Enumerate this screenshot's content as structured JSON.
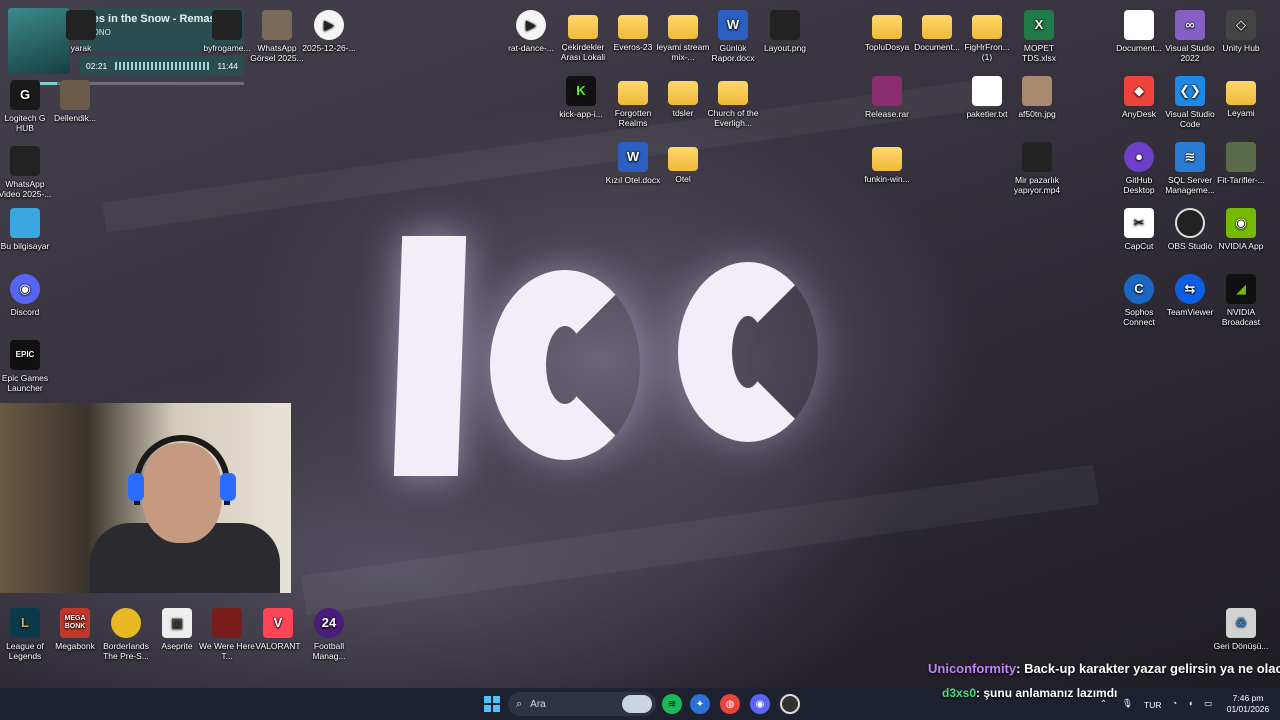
{
  "media": {
    "title": "hes in the Snow - Remastered",
    "artist": "MONO",
    "elapsed": "02:21",
    "duration": "11:44",
    "progress": 0.2
  },
  "desktop_icons": {
    "yarak": "yarak",
    "byfrogame": "byfrogame...",
    "whatsapp_gorsel": "WhatsApp Görsel 2025...",
    "video_2025": "2025-12-26-...",
    "rat_dance": "rat-dance-...",
    "cekirdekler": "Çekirdekler Arası Lokali",
    "everos": "Everos-23",
    "leyami_stream": "leyami stream mix-...",
    "gunluk_rapor": "Günlük Rapor.docx",
    "layout_png": "Layout.png",
    "toplu_dosya": "TopluDosya",
    "documents1": "Document...",
    "fighfron": "FigHrFron... (1)",
    "mopet": "MOPET TDS.xlsx",
    "documents2": "Document...",
    "vs2022": "Visual Studio 2022",
    "unity_hub": "Unity Hub",
    "logitech": "Logitech G HUB",
    "dellendik": "Dellendik...",
    "kick_app": "kick-app-i...",
    "forgotten_realms": "Forgotten Realms",
    "tdsler": "tdsler",
    "church": "Church of the Everligh...",
    "release_rar": "Release.rar",
    "paketler": "paketler.txt",
    "af50tn": "af50tn.jpg",
    "anydesk": "AnyDesk",
    "vscode": "Visual Studio Code",
    "leyami": "Leyami",
    "whatsapp_video": "WhatsApp Video 2025-...",
    "kizil_otel": "Kızıl Otel.docx",
    "otel": "Otel",
    "funkin": "funkin-win...",
    "mir_pazarlik": "Mir pazarlık yapıyor.mp4",
    "github": "GitHub Desktop",
    "sql_server": "SQL Server Manageme...",
    "fit_tarifler": "Fit-Tarifler-...",
    "bu_bilgisayar": "Bu bilgisayar",
    "capcut": "CapCut",
    "obs": "OBS Studio",
    "nvidia_app": "NVIDIA App",
    "discord": "Discord",
    "sophos": "Sophos Connect",
    "teamviewer": "TeamViewer",
    "nvidia_broadcast": "NVIDIA Broadcast",
    "epic": "Epic Games Launcher",
    "lol": "League of Legends",
    "megabonk": "Megabonk",
    "borderlands": "Borderlands The Pre-S...",
    "aseprite": "Aseprite",
    "we_were_here": "We Were Here T...",
    "valorant": "VALORANT",
    "football": "Football Manag...",
    "recycle": "Geri Dönüşü..."
  },
  "icon_glyphs": {
    "epic": "EPIC",
    "megabonk": "MEGA BONK",
    "kick": "K",
    "football": "24"
  },
  "chat": [
    {
      "user": "Uniconformity",
      "message": ": Back-up karakter yazar gelirsin ya ne olacak"
    },
    {
      "user": "d3xs0",
      "message": ": şunu anlamanız lazımdı"
    }
  ],
  "taskbar": {
    "search_placeholder": "Ara",
    "language": "TUR",
    "time": "7:46 pm",
    "date": "01/01/2026"
  },
  "colors": {
    "accent": "#4cc2ff",
    "taskbar_bg": "#1e2230",
    "chat_user1": "#c084fc",
    "chat_user2": "#4ade80"
  }
}
